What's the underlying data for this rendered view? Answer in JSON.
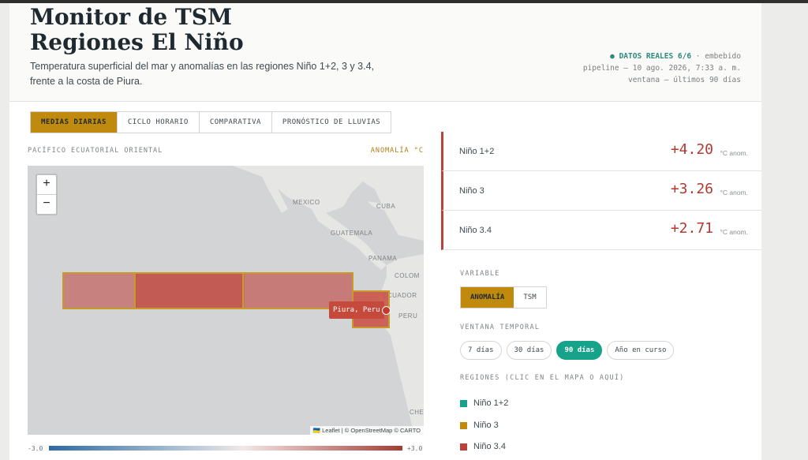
{
  "header": {
    "title_line1": "Monitor de TSM",
    "title_line2": "Regiones El Niño",
    "subtitle": "Temperatura superficial del mar y anomalías en las regiones Niño 1+2, 3 y 3.4, frente a la costa de Piura.",
    "status": "● DATOS REALES 6/6",
    "status_suffix": " · embebido",
    "pipeline": "pipeline — 10 ago. 2026, 7:33 a. m.",
    "window": "ventana — últimos 90 días"
  },
  "tabs": [
    {
      "label": "MEDIAS DIARIAS",
      "active": true
    },
    {
      "label": "CICLO HORARIO",
      "active": false
    },
    {
      "label": "COMPARATIVA",
      "active": false
    },
    {
      "label": "PRONÓSTICO DE LLUVIAS",
      "active": false
    }
  ],
  "map": {
    "title": "PACÍFICO ECUATORIAL ORIENTAL",
    "metric_label": "ANOMALÍA °C",
    "zoom_in": "+",
    "zoom_out": "−",
    "places": [
      "MEXICO",
      "CUBA",
      "GUATEMALA",
      "PANAMA",
      "COLOM",
      "ECUADOR",
      "PERU",
      "CHE"
    ],
    "tooltip": "Piura, Peru",
    "attribution": "🇺🇦 Leaflet | © OpenStreetMap © CARTO",
    "scale_min": "-3.0",
    "scale_max": "+3.0"
  },
  "stats": [
    {
      "name": "Niño 1+2",
      "value": "+4.20",
      "unit": "°C anom."
    },
    {
      "name": "Niño 3",
      "value": "+3.26",
      "unit": "°C anom."
    },
    {
      "name": "Niño 3.4",
      "value": "+2.71",
      "unit": "°C anom."
    }
  ],
  "controls": {
    "variable_label": "VARIABLE",
    "variable_options": [
      {
        "label": "ANOMALÍA",
        "active": true
      },
      {
        "label": "TSM",
        "active": false
      }
    ],
    "window_label": "VENTANA TEMPORAL",
    "window_options": [
      {
        "label": "7 días",
        "active": false
      },
      {
        "label": "30 días",
        "active": false
      },
      {
        "label": "90 días",
        "active": true
      },
      {
        "label": "Año en curso",
        "active": false
      }
    ],
    "regions_label": "REGIONES (CLIC EN EL MAPA O AQUÍ)",
    "regions": [
      {
        "name": "Niño 1+2",
        "color": "#17a28a"
      },
      {
        "name": "Niño 3",
        "color": "#c08a0e"
      },
      {
        "name": "Niño 3.4",
        "color": "#b8433a"
      }
    ]
  },
  "colors": {
    "accent": "#c08a0e",
    "teal": "#17a28a",
    "anomaly_red": "#b23a30",
    "map_water": "#d2d4d6",
    "map_land": "#e6e6e4"
  }
}
